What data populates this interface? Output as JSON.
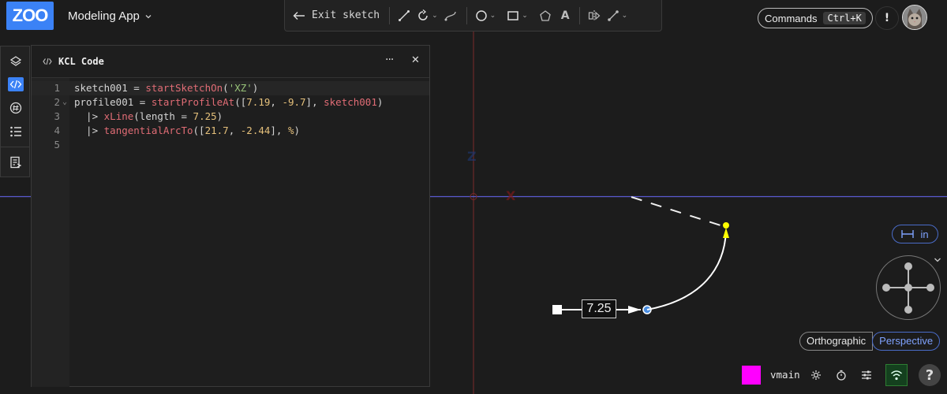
{
  "app": {
    "logo_text": "ZOO",
    "title": "Modeling App"
  },
  "toolbar": {
    "exit_sketch_label": "Exit sketch",
    "tools": [
      "line-icon",
      "tangential-arc-icon",
      "spline-icon",
      "circle-icon",
      "rectangle-icon",
      "polygon-icon",
      "text-icon",
      "mirror-icon",
      "constraint-icon"
    ]
  },
  "header_right": {
    "commands_label": "Commands",
    "commands_shortcut": "Ctrl+K",
    "alert_label": "!"
  },
  "left_strip": {
    "items": [
      "feature-tree-icon",
      "kcl-code-icon",
      "variables-icon",
      "logs-icon",
      "export-icon"
    ],
    "active": "kcl-code-icon"
  },
  "kcl_panel": {
    "title": "KCL Code",
    "lines": [
      {
        "n": "1",
        "text": "sketch001 = startSketchOn('XZ')"
      },
      {
        "n": "2",
        "text": "profile001 = startProfileAt([7.19, -9.7], sketch001)"
      },
      {
        "n": "3",
        "text": "  |> xLine(length = 7.25)"
      },
      {
        "n": "4",
        "text": "  |> tangentialArcTo([21.7, -2.44], %)"
      },
      {
        "n": "5",
        "text": ""
      }
    ]
  },
  "viewport": {
    "dimension_label": "7.25",
    "axis_label_z": "Z",
    "axis_label_x": "X",
    "colors": {
      "x_axis": "#5a5ad0",
      "z_axis": "#8b2f2f",
      "selected_point": "#ffff00"
    }
  },
  "view_controls": {
    "units_label": "in",
    "projection": {
      "ortho_label": "Orthographic",
      "persp_label": "Perspective",
      "active": "Perspective"
    }
  },
  "bottom_bar": {
    "swatch_color": "#ff00ff",
    "branch": "vmain",
    "help_label": "?"
  }
}
